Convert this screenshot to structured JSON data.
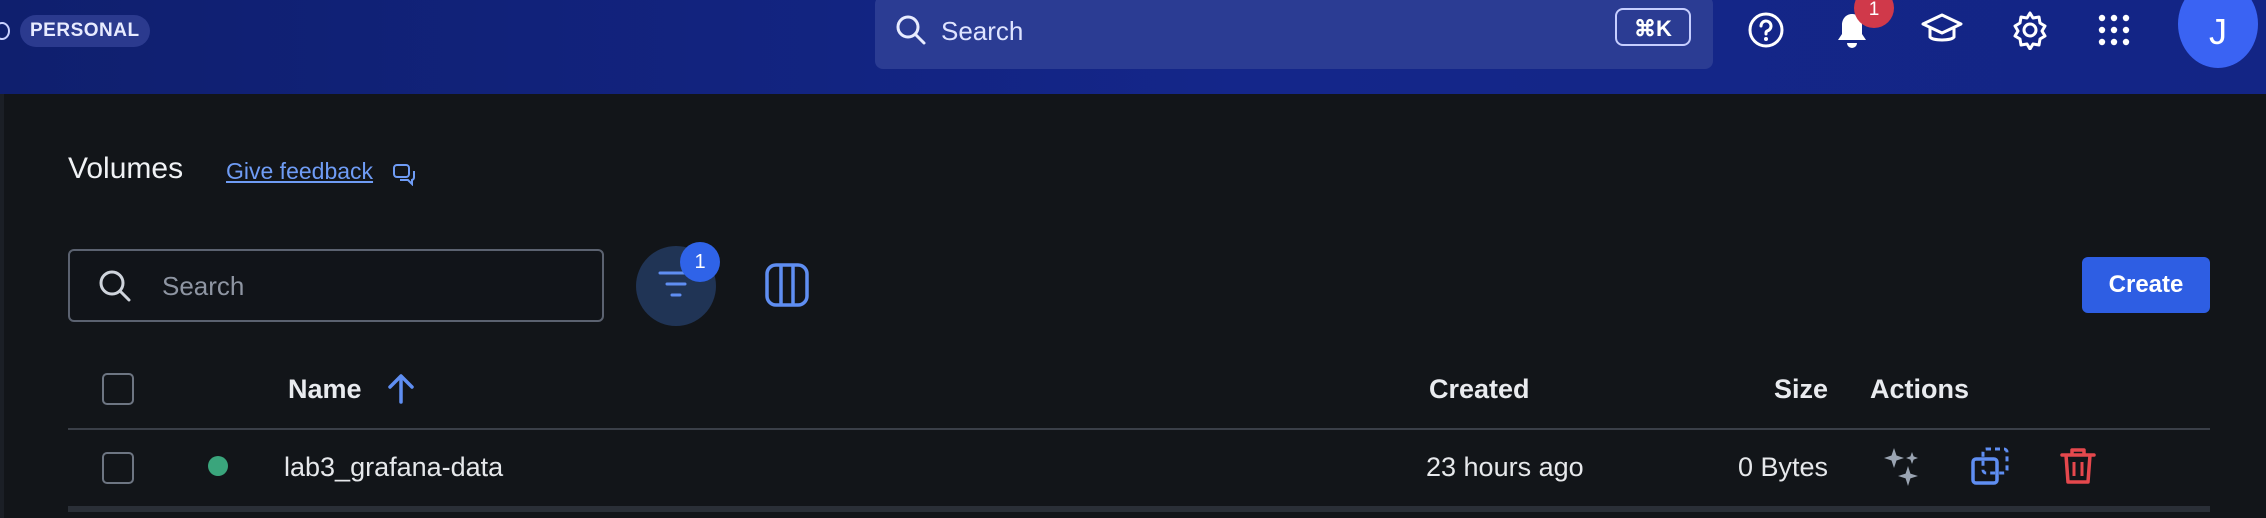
{
  "header": {
    "org_badge": "PERSONAL",
    "search_label": "Search",
    "shortcut": "⌘K",
    "notification_count": "1",
    "avatar_initial": "J",
    "icons": [
      "help-icon",
      "bell-icon",
      "graduation-cap-icon",
      "gear-icon",
      "apps-grid-icon"
    ]
  },
  "page": {
    "title": "Volumes",
    "feedback_link": "Give feedback"
  },
  "toolbar": {
    "search_placeholder": "Search",
    "filter_count": "1",
    "create_label": "Create"
  },
  "table": {
    "columns": {
      "name": "Name",
      "created": "Created",
      "size": "Size",
      "actions": "Actions"
    },
    "sort": {
      "column": "Name",
      "direction": "ascending"
    },
    "rows": [
      {
        "name": "lab3_grafana-data",
        "created": "23 hours ago",
        "size": "0 Bytes",
        "status_color": "#3aa57c"
      }
    ]
  },
  "colors": {
    "header_bg": "#14268a",
    "accent": "#2e5ee3",
    "link": "#6f9cf5",
    "danger": "#e5484d"
  }
}
